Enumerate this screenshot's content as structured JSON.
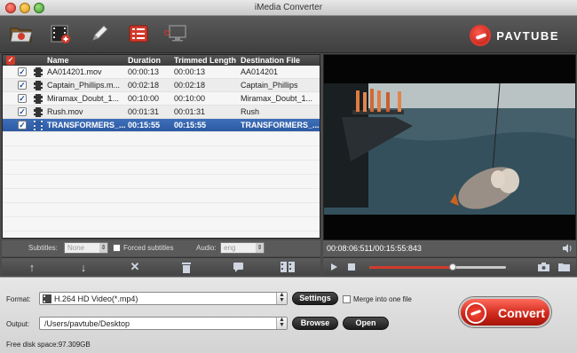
{
  "window": {
    "title": "iMedia Converter"
  },
  "toolbar": {
    "icons": [
      "folder-open-icon",
      "add-video-icon",
      "edit-pencil-icon",
      "task-list-icon",
      "monitor-icon"
    ]
  },
  "brand": {
    "name": "PAVTUBE",
    "accent": "#d23b2b"
  },
  "file_list": {
    "columns": [
      "Name",
      "Duration",
      "Trimmed Length",
      "Destination File"
    ],
    "rows": [
      {
        "name": "AA014201.mov",
        "duration": "00:00:13",
        "trimmed": "00:00:13",
        "destination": "AA014201",
        "checked": true,
        "selected": false
      },
      {
        "name": "Captain_Phillips.m...",
        "duration": "00:02:18",
        "trimmed": "00:02:18",
        "destination": "Captain_Phillips",
        "checked": true,
        "selected": false
      },
      {
        "name": "Miramax_Doubt_1...",
        "duration": "00:10:00",
        "trimmed": "00:10:00",
        "destination": "Miramax_Doubt_1...",
        "checked": true,
        "selected": false
      },
      {
        "name": "Rush.mov",
        "duration": "00:01:31",
        "trimmed": "00:01:31",
        "destination": "Rush",
        "checked": true,
        "selected": false
      },
      {
        "name": "TRANSFORMERS_...",
        "duration": "00:15:55",
        "trimmed": "00:15:55",
        "destination": "TRANSFORMERS_...",
        "checked": true,
        "selected": true
      }
    ]
  },
  "subtitle_bar": {
    "subtitles_label": "Subtitles:",
    "subtitles_value": "None",
    "forced_label": "Forced subtitles",
    "audio_label": "Audio:",
    "audio_value": "eng"
  },
  "list_controls": [
    "move-up-icon",
    "move-down-icon",
    "remove-icon",
    "trash-icon",
    "comment-icon",
    "merge-grid-icon"
  ],
  "player": {
    "time_display": "00:08:06:511/00:15:55:843",
    "progress": 0.61
  },
  "output": {
    "format_label": "Format:",
    "format_value": "H.264 HD Video(*.mp4)",
    "settings_label": "Settings",
    "merge_label": "Merge into one file",
    "output_label": "Output:",
    "output_path": "/Users/pavtube/Desktop",
    "browse_label": "Browse",
    "open_label": "Open",
    "free_disk": "Free disk space:97.309GB",
    "convert_label": "Convert"
  }
}
